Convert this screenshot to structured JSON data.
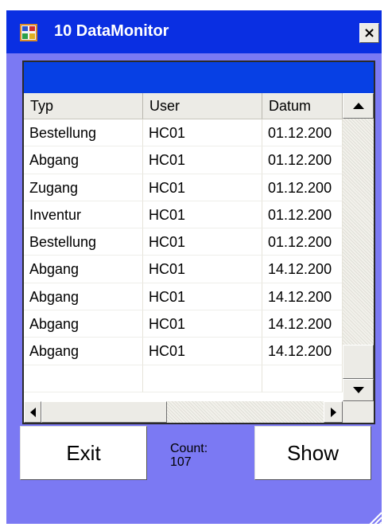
{
  "window": {
    "title": "10 DataMonitor",
    "close_glyph": "×"
  },
  "grid": {
    "columns": [
      "Typ",
      "User",
      "Datum"
    ],
    "rows": [
      [
        "Bestellung",
        "HC01",
        "01.12.200"
      ],
      [
        "Abgang",
        "HC01",
        "01.12.200"
      ],
      [
        "Zugang",
        "HC01",
        "01.12.200"
      ],
      [
        "Inventur",
        "HC01",
        "01.12.200"
      ],
      [
        "Bestellung",
        "HC01",
        "01.12.200"
      ],
      [
        "Abgang",
        "HC01",
        "14.12.200"
      ],
      [
        "Abgang",
        "HC01",
        "14.12.200"
      ],
      [
        "Abgang",
        "HC01",
        "14.12.200"
      ],
      [
        "Abgang",
        "HC01",
        "14.12.200"
      ]
    ]
  },
  "buttons": {
    "exit": "Exit",
    "show": "Show"
  },
  "count": {
    "label": "Count:",
    "value": "107"
  },
  "icons": {
    "app": "app-icon",
    "close": "close-icon",
    "scroll_up": "arrow-up-icon",
    "scroll_down": "arrow-down-icon",
    "scroll_left": "arrow-left-icon",
    "scroll_right": "arrow-right-icon",
    "grip": "resize-grip-icon"
  },
  "colors": {
    "titlebar": "#0a2fe2",
    "window_bg": "#7b79f3",
    "grid_caption": "#0740e4"
  }
}
